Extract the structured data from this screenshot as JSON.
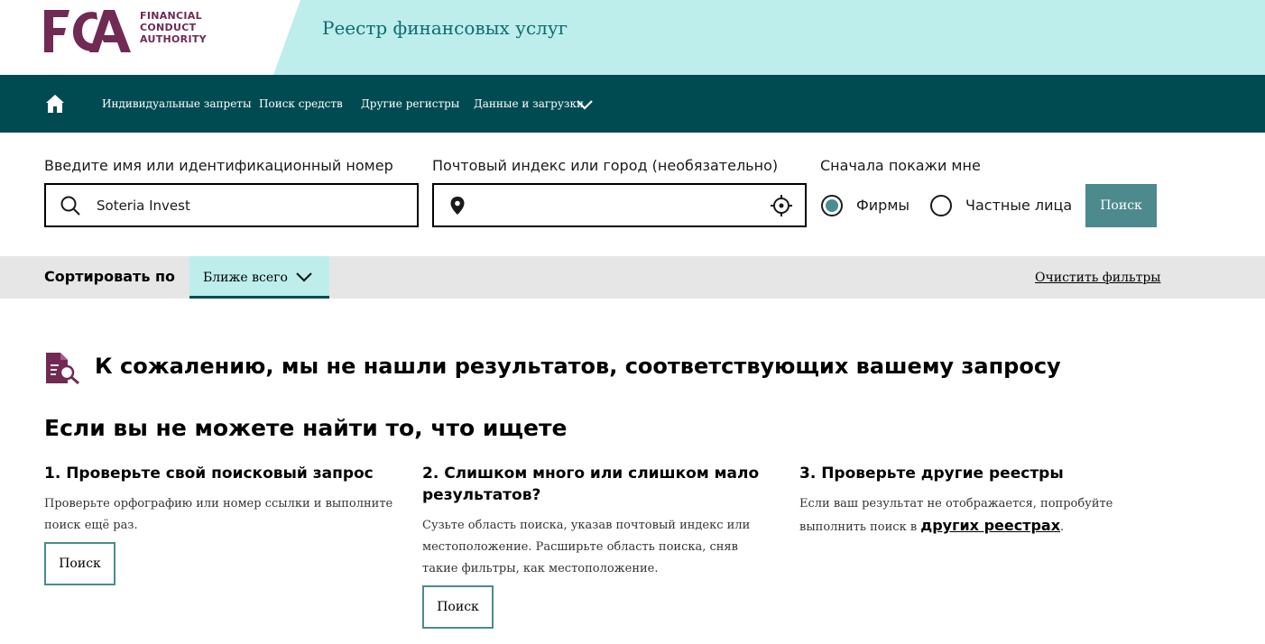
{
  "header": {
    "logo_letters": "FCA",
    "logo_text": [
      "FINANCIAL",
      "CONDUCT",
      "AUTHORITY"
    ],
    "register_title": "Реестр финансовых услуг",
    "brand_color": "#702a53",
    "teal_color": "#bdeeeb"
  },
  "nav": {
    "home_icon": "home-icon",
    "items": [
      {
        "label": "Индивидуальные запреты"
      },
      {
        "label": "Поиск средств"
      },
      {
        "label": "Другие регистры"
      },
      {
        "label": "Данные и загрузки"
      }
    ],
    "background": "#004b52"
  },
  "search": {
    "name_label": "Введите имя или идентификационный номер",
    "name_value": "Soteria Invest",
    "location_label": "Почтовый индекс или город (необязательно)",
    "location_value": "",
    "show_first_label": "Сначала покажи мне",
    "radio_options": [
      {
        "label": "Фирмы",
        "checked": true
      },
      {
        "label": "Частные лица",
        "checked": false
      }
    ],
    "button_label": "Поиск"
  },
  "sort": {
    "label": "Сортировать по",
    "selected": "Ближе всего",
    "clear_filters": "Очистить фильтры"
  },
  "results": {
    "no_results_title": "К сожалению, мы не нашли результатов, соответствующих вашему запросу",
    "help_title": "Если вы не можете найти то, что ищете",
    "tips": [
      {
        "heading": "1. Проверьте свой поисковый запрос",
        "body": "Проверьте орфографию или номер ссылки и выполните поиск ещё раз.",
        "button": "Поиск"
      },
      {
        "heading": "2. Слишком много или слишком мало результатов?",
        "body": "Сузьте область поиска, указав почтовый индекс или местоположение. Расширьте область поиска, сняв такие фильтры, как местоположение.",
        "button": "Поиск"
      },
      {
        "heading": "3. Проверьте другие реестры",
        "body_prefix": "Если ваш результат не отображается, попробуйте выполнить поиск в ",
        "link": "других реестрах",
        "body_suffix": "."
      }
    ]
  }
}
